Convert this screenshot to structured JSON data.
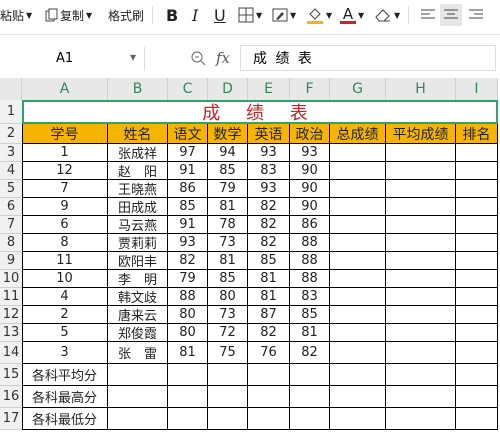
{
  "toolbar": {
    "paste": "粘贴",
    "copy": "复制",
    "format_painter": "格式刷",
    "bold": "B",
    "italic": "I",
    "underline": "U",
    "font_color_letter": "A",
    "colors": {
      "font": "#d02020",
      "fill": "#f4b400"
    }
  },
  "formula_bar": {
    "name_box": "A1",
    "fx": "fx",
    "content": "成 绩 表"
  },
  "columns": [
    "A",
    "B",
    "C",
    "D",
    "E",
    "F",
    "G",
    "H",
    "I"
  ],
  "rows": [
    "1",
    "2",
    "3",
    "4",
    "5",
    "6",
    "7",
    "8",
    "9",
    "10",
    "11",
    "12",
    "13",
    "14",
    "15",
    "16",
    "17"
  ],
  "sheet": {
    "title": "成 绩 表",
    "headers": [
      "学号",
      "姓名",
      "语文",
      "数学",
      "英语",
      "政治",
      "总成绩",
      "平均成绩",
      "排名"
    ],
    "data": [
      [
        "1",
        "张成祥",
        "97",
        "94",
        "93",
        "93"
      ],
      [
        "12",
        "赵　阳",
        "91",
        "85",
        "83",
        "90"
      ],
      [
        "7",
        "王晓燕",
        "86",
        "79",
        "93",
        "90"
      ],
      [
        "9",
        "田成成",
        "85",
        "81",
        "82",
        "90"
      ],
      [
        "6",
        "马云燕",
        "91",
        "78",
        "82",
        "86"
      ],
      [
        "8",
        "贾莉莉",
        "93",
        "73",
        "82",
        "88"
      ],
      [
        "11",
        "欧阳丰",
        "82",
        "81",
        "85",
        "88"
      ],
      [
        "10",
        "李　明",
        "79",
        "85",
        "81",
        "88"
      ],
      [
        "4",
        "韩文歧",
        "88",
        "80",
        "81",
        "83"
      ],
      [
        "2",
        "唐来云",
        "80",
        "73",
        "87",
        "85"
      ],
      [
        "5",
        "郑俊霞",
        "80",
        "72",
        "82",
        "81"
      ],
      [
        "3",
        "张　雷",
        "81",
        "75",
        "76",
        "82"
      ]
    ],
    "footer_labels": [
      "各科平均分",
      "各科最高分",
      "各科最低分"
    ]
  }
}
